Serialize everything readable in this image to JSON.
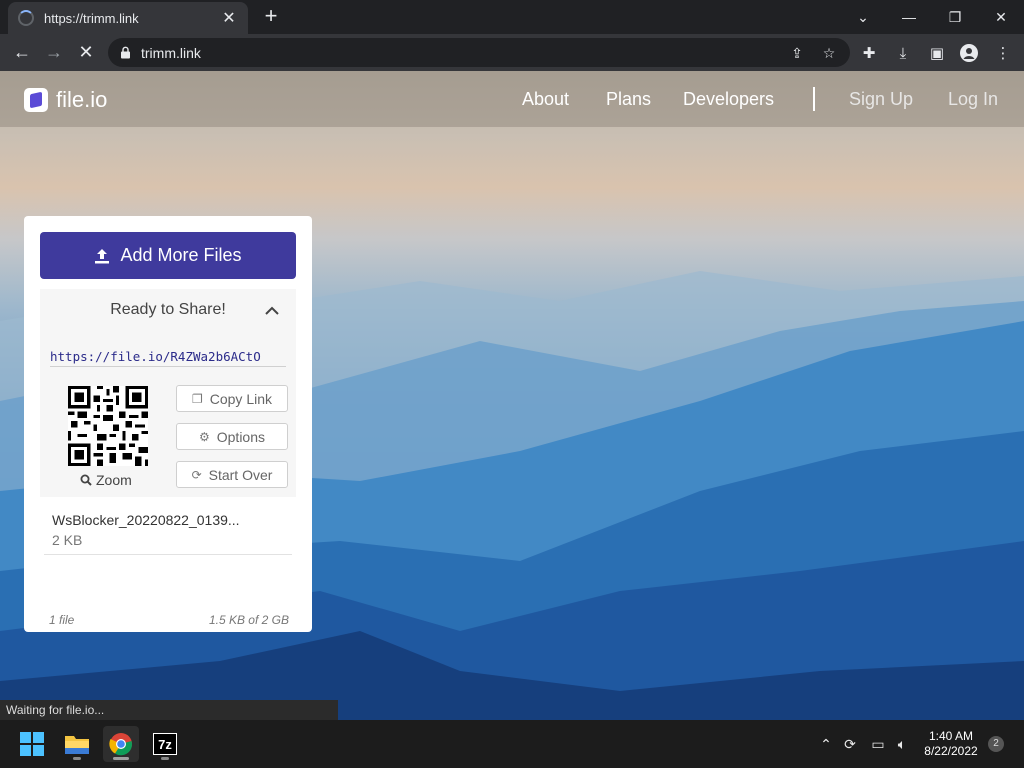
{
  "browser": {
    "tab_title": "https://trimm.link",
    "url": "trimm.link",
    "status_text": "Waiting for file.io..."
  },
  "site": {
    "logo_text": "file.io",
    "nav": [
      "About",
      "Plans",
      "Developers"
    ],
    "auth": [
      "Sign Up",
      "Log In"
    ]
  },
  "upload": {
    "add_button_label": "Add More Files",
    "share_heading": "Ready to Share!",
    "share_link": "https://file.io/R4ZWa2b6ACtO",
    "zoom_label": "Zoom",
    "actions": [
      "Copy Link",
      "Options",
      "Start Over"
    ],
    "file": {
      "name": "WsBlocker_20220822_0139...",
      "size": "2 KB"
    },
    "footer_count": "1 file",
    "footer_quota": "1.5 KB of 2 GB"
  },
  "taskbar": {
    "time": "1:40 AM",
    "date": "8/22/2022",
    "notification_count": "2"
  },
  "colors": {
    "brand": "#3f3a9d",
    "link": "#2b2b8a"
  }
}
